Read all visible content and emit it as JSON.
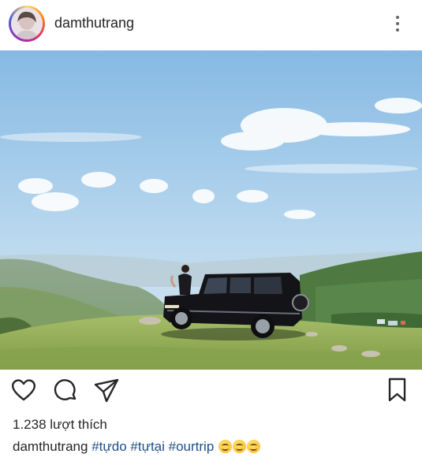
{
  "post": {
    "username": "damthutrang",
    "more_icon": "more-vertical-icon",
    "likes_text": "1.238 lượt thích",
    "caption": {
      "username": "damthutrang",
      "hashtags": [
        "#tựdo",
        "#tựtại",
        "#ourtrip"
      ],
      "emoji_count": 3
    }
  },
  "actions": {
    "like_icon": "heart-icon",
    "comment_icon": "comment-bubble-icon",
    "share_icon": "paper-plane-icon",
    "save_icon": "bookmark-icon"
  },
  "colors": {
    "text": "#262626",
    "hashtag": "#1f4f86",
    "sky": "#8fc1e6",
    "grass": "#9fb65c"
  }
}
